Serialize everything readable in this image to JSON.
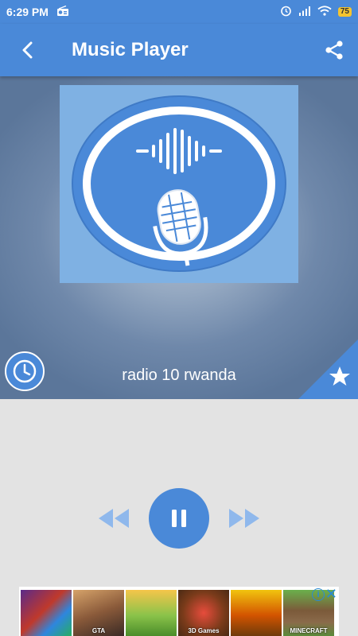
{
  "status": {
    "time": "6:29 PM",
    "battery": "75"
  },
  "header": {
    "title": "Music Player"
  },
  "player": {
    "station_name": "radio 10 rwanda"
  },
  "ads": {
    "tiles": [
      {
        "label": ""
      },
      {
        "label": "GTA"
      },
      {
        "label": ""
      },
      {
        "label": "3D Games"
      },
      {
        "label": ""
      },
      {
        "label": "MINECRAFT"
      }
    ],
    "info": "i",
    "close": "✕"
  },
  "colors": {
    "accent": "#4a89d8",
    "background": "#e3e3e3"
  }
}
